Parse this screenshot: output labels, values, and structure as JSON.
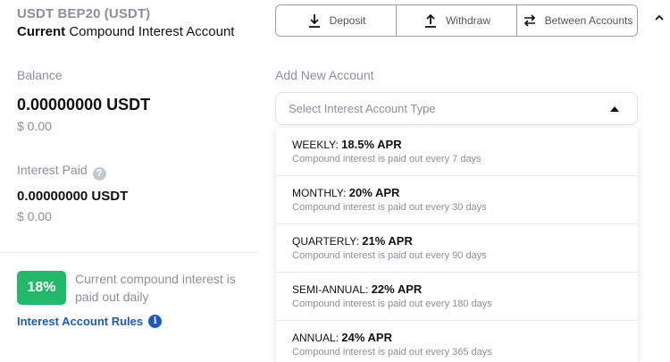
{
  "account": {
    "title": "USDT BEP20 (USDT)",
    "subtitle_bold": "Current",
    "subtitle_rest": " Compound Interest Account"
  },
  "actions": {
    "deposit": "Deposit",
    "withdraw": "Withdraw",
    "between": "Between Accounts"
  },
  "balance": {
    "label": "Balance",
    "value": "0.00000000 USDT",
    "usd": "$ 0.00"
  },
  "interest_paid": {
    "label": "Interest Paid",
    "help": "?",
    "value": "0.00000000 USDT",
    "usd": "$ 0.00"
  },
  "current_rate": {
    "badge": "18%",
    "text": "Current compound interest is paid out daily"
  },
  "rules_link": {
    "label": "Interest Account Rules",
    "icon": "i"
  },
  "add_account": {
    "label": "Add New Account",
    "placeholder": "Select Interest Account Type",
    "options": [
      {
        "name": "WEEKLY: ",
        "apr": "18.5% APR",
        "desc": "Compound interest is paid out every 7 days"
      },
      {
        "name": "MONTHLY: ",
        "apr": "20% APR",
        "desc": "Compound interest is paid out every 30 days"
      },
      {
        "name": "QUARTERLY: ",
        "apr": "21% APR",
        "desc": "Compound interest is paid out every 90 days"
      },
      {
        "name": "SEMI-ANNUAL: ",
        "apr": "22% APR",
        "desc": "Compound interest is paid out every 180 days"
      },
      {
        "name": "ANNUAL: ",
        "apr": "24% APR",
        "desc": "Compound interest is paid out every 365 days"
      }
    ]
  },
  "colors": {
    "accent_green": "#23b96a",
    "link_blue": "#1d5bb8",
    "muted_gray": "#8a8f99"
  }
}
